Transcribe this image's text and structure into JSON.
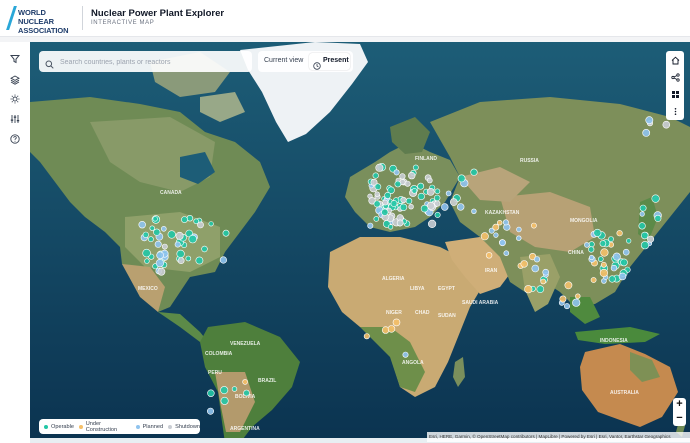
{
  "header": {
    "logo_line1": "WORLD NUCLEAR",
    "logo_line2": "ASSOCIATION",
    "title": "Nuclear Power Plant Explorer",
    "subtitle": "INTERACTIVE MAP"
  },
  "sidebar": {
    "items": [
      {
        "icon": "filter-icon"
      },
      {
        "icon": "layers-icon"
      },
      {
        "icon": "sun-icon"
      },
      {
        "icon": "sliders-icon"
      },
      {
        "icon": "help-icon"
      }
    ]
  },
  "search": {
    "placeholder": "Search countries, plants or reactors"
  },
  "time_toggle": {
    "current_label": "Current view",
    "present_label": "Present"
  },
  "map_tools": [
    {
      "icon": "home-icon"
    },
    {
      "icon": "share-icon"
    },
    {
      "icon": "grid-icon"
    },
    {
      "icon": "more-icon"
    }
  ],
  "zoom": {
    "in": "+",
    "out": "−"
  },
  "legend": [
    {
      "label": "Operable",
      "color": "#22c7a6"
    },
    {
      "label": "Under Construction",
      "color": "#f5c06a"
    },
    {
      "label": "Planned",
      "color": "#8fc3ee"
    },
    {
      "label": "Shutdown",
      "color": "#c9cdd3"
    }
  ],
  "attribution": "Esri, HERE, Garmin, © OpenStreetMap contributors | MapLibre | Powered by Esri | Esri, Vantor, Earthstar Geographics",
  "map_labels": [
    "CANADA",
    "RUSSIA",
    "KAZAKHSTAN",
    "CHINA",
    "ALGERIA",
    "LIBYA",
    "EGYPT",
    "SAUDI ARABIA",
    "NIGER",
    "CHAD",
    "SUDAN",
    "ANGOLA",
    "BRAZIL",
    "PERU",
    "BOLIVIA",
    "ARGENTINA",
    "VENEZUELA",
    "COLOMBIA",
    "MEXICO",
    "AUSTRALIA",
    "INDONESIA",
    "IRAN",
    "MONGOLIA",
    "FINLAND"
  ]
}
